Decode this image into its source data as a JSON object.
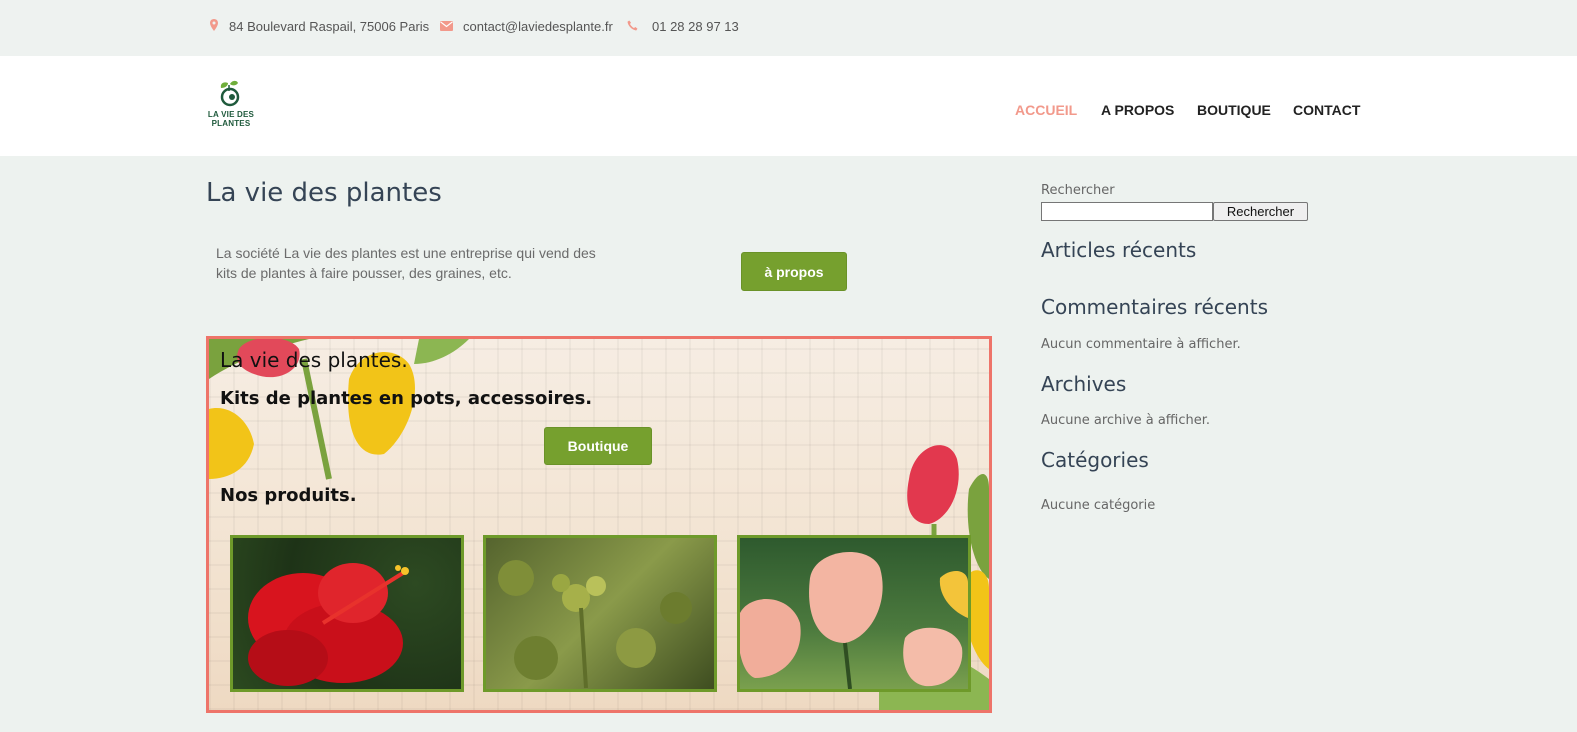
{
  "topbar": {
    "address": "84 Boulevard Raspail, 75006 Paris",
    "email": "contact@laviedesplante.fr",
    "phone": "01 28 28 97 13"
  },
  "header": {
    "logo_line1": "LA VIE DES",
    "logo_line2": "PLANTES",
    "nav": [
      "ACCUEIL",
      "A PROPOS",
      "BOUTIQUE",
      "CONTACT"
    ],
    "active_nav": "ACCUEIL"
  },
  "main": {
    "title": "La vie des plantes",
    "intro": "La société La vie des plantes est une entreprise qui vend des kits de plantes à faire pousser, des graines, etc.",
    "about_button": "à propos",
    "hero": {
      "title": "La vie des plantes.",
      "subtitle": "Kits de plantes en pots, accessoires.",
      "button": "Boutique",
      "products_heading": "Nos produits."
    }
  },
  "sidebar": {
    "search_label": "Rechercher",
    "search_button": "Rechercher",
    "recent_posts": "Articles récents",
    "recent_comments": "Commentaires récents",
    "no_comments": "Aucun commentaire à afficher.",
    "archives": "Archives",
    "no_archives": "Aucune archive à afficher.",
    "categories": "Catégories",
    "no_categories": "Aucune catégorie"
  },
  "colors": {
    "accent": "#f2998b",
    "button_green": "#76a02e",
    "hero_border": "#ee7469",
    "thumb_border": "#6e9a2a"
  }
}
